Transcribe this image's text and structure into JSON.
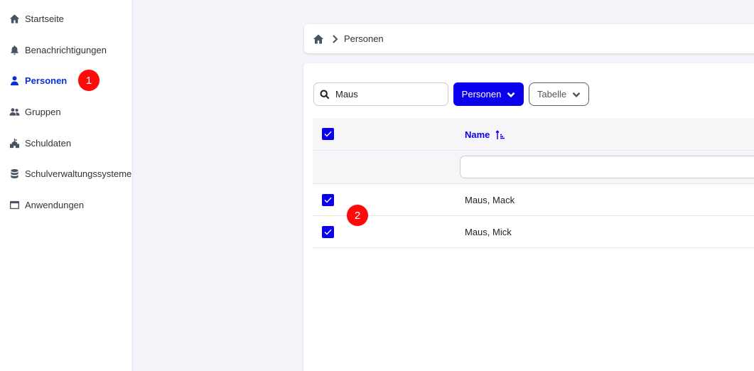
{
  "sidebar": {
    "items": [
      {
        "label": "Startseite",
        "icon": "home-icon"
      },
      {
        "label": "Benachrichtigungen",
        "icon": "bell-icon"
      },
      {
        "label": "Personen",
        "icon": "person-icon",
        "active": true
      },
      {
        "label": "Gruppen",
        "icon": "group-icon"
      },
      {
        "label": "Schuldaten",
        "icon": "school-icon"
      },
      {
        "label": "Schulverwaltungssysteme",
        "icon": "database-icon"
      },
      {
        "label": "Anwendungen",
        "icon": "window-icon"
      }
    ]
  },
  "markers": [
    "1",
    "2"
  ],
  "breadcrumb": {
    "home_icon": "home-icon",
    "current": "Personen"
  },
  "toolbar": {
    "search_value": "Maus",
    "search_placeholder": "",
    "personen_button": "Personen",
    "tabelle_button": "Tabelle"
  },
  "table": {
    "name_header": "Name",
    "sort": "ascending",
    "rows": [
      {
        "name": "Maus, Mack",
        "checked": true
      },
      {
        "name": "Maus, Mick",
        "checked": true
      }
    ]
  },
  "colors": {
    "accent": "#0a00ee",
    "active_nav": "#0a2fd6",
    "marker": "#ff0a0a"
  }
}
